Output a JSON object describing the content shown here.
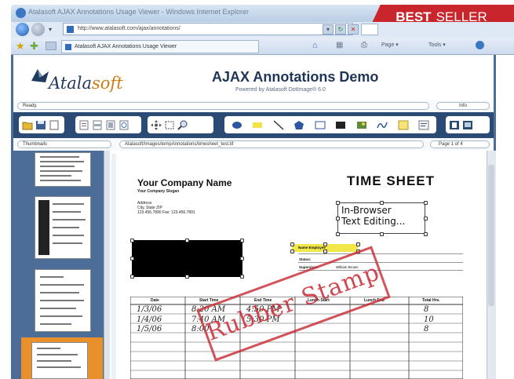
{
  "browser": {
    "window_title": "Atalasoft AJAX Annotations Usage Viewer - Windows Internet Explorer",
    "address": "http://www.atalasoft.com/ajax/annotations/",
    "tab_label": "Atalasoft AJAX Annotations Usage Viewer",
    "commands": [
      "Page ▾",
      "Tools ▾"
    ]
  },
  "badge": {
    "best": "BEST",
    "seller": "SELLER"
  },
  "app": {
    "logo_main": "Atala",
    "logo_soft": "soft",
    "title": "AJAX Annotations Demo",
    "subtitle": "Powered by Atalasoft DotImage® 6.0",
    "status": "Ready.",
    "info": "Info",
    "file_label": "Thumbnails",
    "path": "Atalasoft/Images/tempAnnotations/timesheet_test.tif",
    "page_indicator": "Page 1 of 4"
  },
  "document": {
    "company": "Your Company Name",
    "slogan": "Your Company Slogan",
    "address_lines": [
      "Address",
      "City, State ZIP",
      "123.456.7890  Fax: 123.456.7891"
    ],
    "heading": "TIME SHEET",
    "text_annotation_line1": "In-Browser",
    "text_annotation_line2": "Text Editing...",
    "stamp": "Rubber Stamp",
    "form_labels": {
      "name": "Name:",
      "status": "Status:",
      "supervisor": "Supervisor:",
      "supervisor_value": "William Brown"
    },
    "highlight_text": "Name   Employee",
    "table_headers": [
      "Date",
      "Start Time",
      "End Time",
      "Lunch Start",
      "Lunch End",
      "Total Hrs."
    ],
    "rows": [
      {
        "date": "1/3/06",
        "start": "8:20 AM",
        "end": "4:50 PM",
        "total": "8"
      },
      {
        "date": "1/4/06",
        "start": "7:40 AM",
        "end": "5:30 PM",
        "total": "10"
      },
      {
        "date": "1/5/06",
        "start": "8:00",
        "end": "",
        "total": "8"
      }
    ]
  },
  "colors": {
    "accent": "#c8252c",
    "toolbar": "#2c4b74",
    "selected_thumb": "#e8902c"
  }
}
